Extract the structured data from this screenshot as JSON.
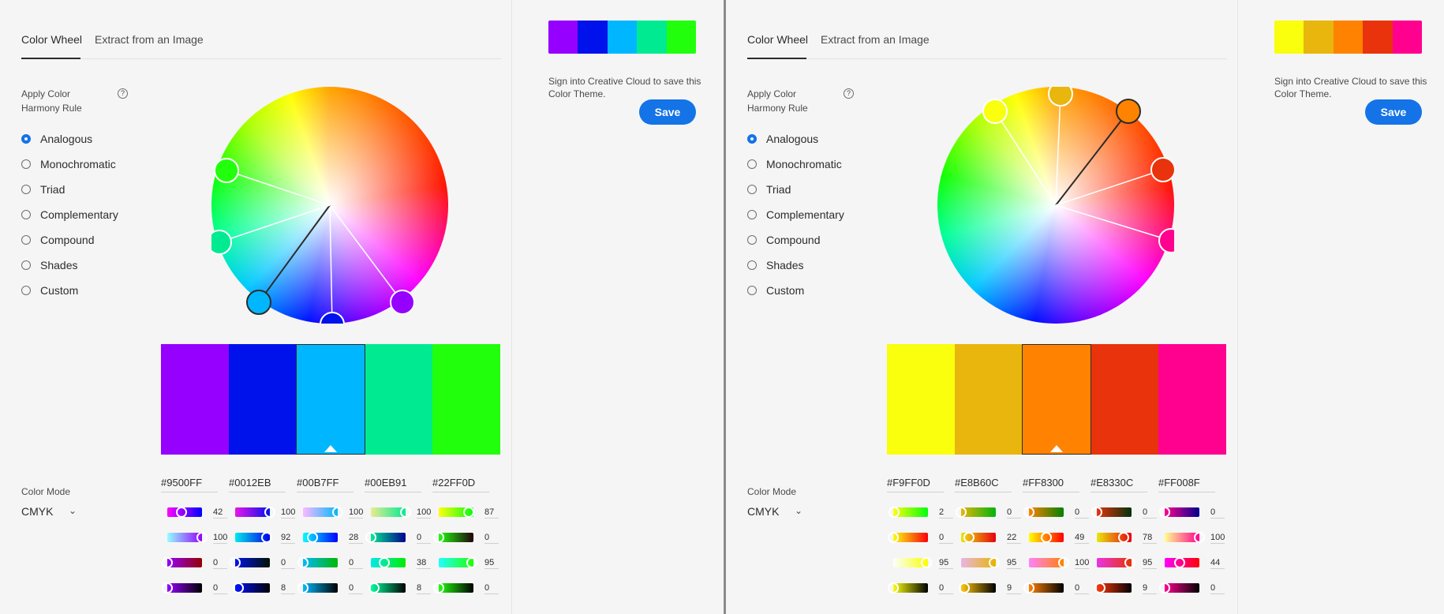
{
  "tabs": {
    "color_wheel": "Color Wheel",
    "extract": "Extract from an Image"
  },
  "harmony": {
    "label": "Apply Color Harmony Rule",
    "help_icon": "?",
    "rules": [
      "Analogous",
      "Monochromatic",
      "Triad",
      "Complementary",
      "Compound",
      "Shades",
      "Custom"
    ],
    "selected": "Analogous"
  },
  "color_mode": {
    "label": "Color Mode",
    "value": "CMYK",
    "chevron": "⌄"
  },
  "signin_text": "Sign into Creative Cloud to save this Color Theme.",
  "save_label": "Save",
  "panels": [
    {
      "selected_index": 2,
      "swatches": [
        {
          "hex": "#9500FF",
          "cmyk": [
            42,
            100,
            0,
            0
          ]
        },
        {
          "hex": "#0012EB",
          "cmyk": [
            100,
            92,
            0,
            8
          ]
        },
        {
          "hex": "#00B7FF",
          "cmyk": [
            100,
            28,
            0,
            0
          ]
        },
        {
          "hex": "#00EB91",
          "cmyk": [
            100,
            0,
            38,
            8
          ]
        },
        {
          "hex": "#22FF0D",
          "cmyk": [
            87,
            0,
            95,
            0
          ]
        }
      ]
    },
    {
      "selected_index": 2,
      "swatches": [
        {
          "hex": "#F9FF0D",
          "cmyk": [
            2,
            0,
            95,
            0
          ]
        },
        {
          "hex": "#E8B60C",
          "cmyk": [
            0,
            22,
            95,
            9
          ]
        },
        {
          "hex": "#FF8300",
          "cmyk": [
            0,
            49,
            100,
            0
          ]
        },
        {
          "hex": "#E8330C",
          "cmyk": [
            0,
            78,
            95,
            9
          ]
        },
        {
          "hex": "#FF008F",
          "cmyk": [
            0,
            100,
            44,
            0
          ]
        }
      ]
    }
  ],
  "colors": {
    "accent": "#1473e6",
    "text": "#2c2c2c"
  },
  "icons": {
    "help": "help-circle-icon",
    "chevron": "chevron-down-icon",
    "selected_marker": "triangle-up-icon"
  }
}
